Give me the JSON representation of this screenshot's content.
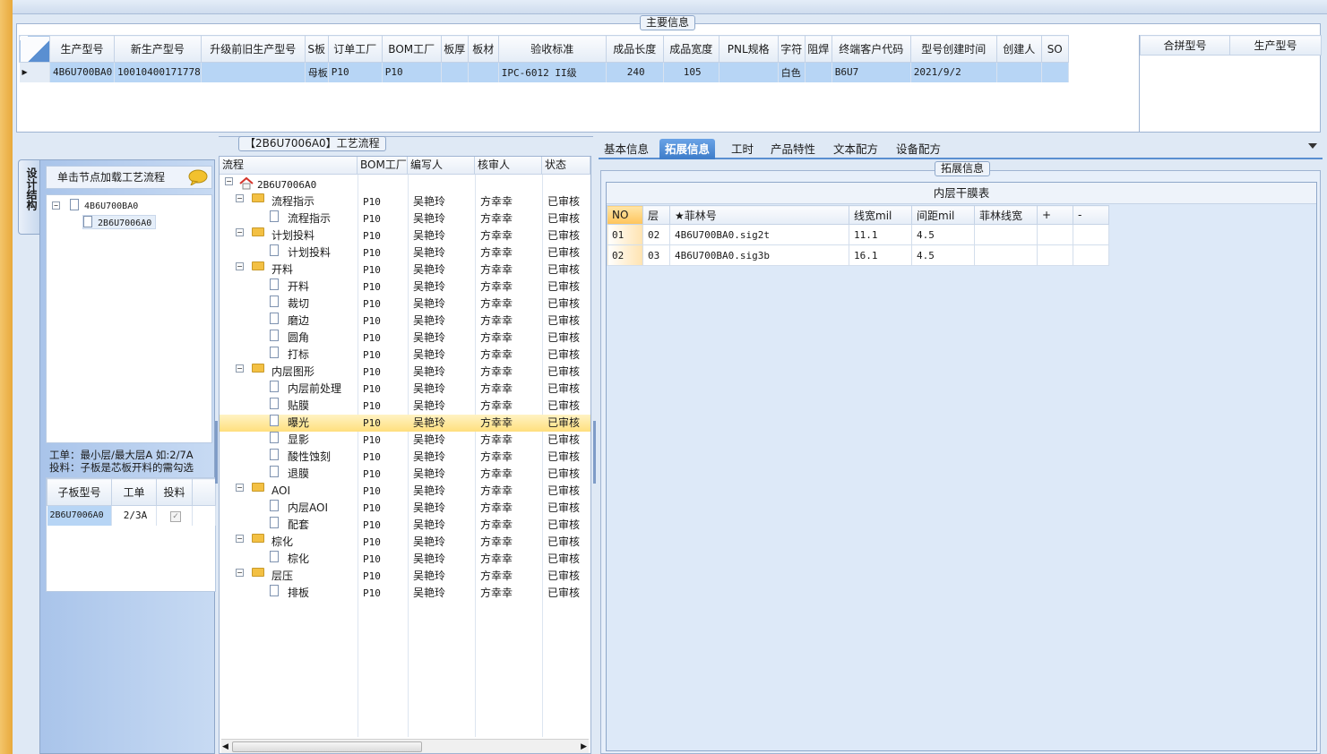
{
  "main_info": {
    "title": "主要信息",
    "columns": [
      "生产型号",
      "新生产型号",
      "升级前旧生产型号",
      "S板",
      "订单工厂",
      "BOM工厂",
      "板厚",
      "板材",
      "验收标准",
      "成品长度",
      "成品宽度",
      "PNL规格",
      "字符",
      "阻焊",
      "终端客户代码",
      "型号创建时间",
      "创建人",
      "SO"
    ],
    "row": [
      "4B6U700BA0",
      "10010400171778",
      "",
      "母板",
      "P10",
      "P10",
      "",
      "",
      "IPC-6012 II级",
      "240",
      "105",
      "",
      "白色",
      "",
      "B6U7",
      "2021/9/2",
      "",
      ""
    ]
  },
  "merge": {
    "columns": [
      "合拼型号",
      "生产型号"
    ]
  },
  "left": {
    "vertical_tab": "设计结构",
    "load_hint": "单击节点加载工艺流程",
    "tree": {
      "root": "4B6U700BA0",
      "child": "2B6U7006A0"
    },
    "note_line1": "工单：最小层/最大层A 如:2/7A",
    "note_line2": "投料：子板是芯板开料的需勾选",
    "sub_table": {
      "columns": [
        "子板型号",
        "工单",
        "投料"
      ],
      "rows": [
        {
          "model": "2B6U7006A0",
          "order": "2/3A",
          "feed": true
        }
      ]
    }
  },
  "process": {
    "title": "【2B6U7006A0】工艺流程",
    "columns": [
      "流程",
      "BOM工厂",
      "编写人",
      "核审人",
      "状态"
    ],
    "root": "2B6U7006A0",
    "rows": [
      {
        "level": 1,
        "name": "流程指示",
        "factory": "P10",
        "writer": "吴艳玲",
        "reviewer": "方幸幸",
        "status": "已审核"
      },
      {
        "level": 2,
        "name": "流程指示",
        "factory": "P10",
        "writer": "吴艳玲",
        "reviewer": "方幸幸",
        "status": "已审核"
      },
      {
        "level": 1,
        "name": "计划投料",
        "factory": "P10",
        "writer": "吴艳玲",
        "reviewer": "方幸幸",
        "status": "已审核"
      },
      {
        "level": 2,
        "name": "计划投料",
        "factory": "P10",
        "writer": "吴艳玲",
        "reviewer": "方幸幸",
        "status": "已审核"
      },
      {
        "level": 1,
        "name": "开料",
        "factory": "P10",
        "writer": "吴艳玲",
        "reviewer": "方幸幸",
        "status": "已审核"
      },
      {
        "level": 2,
        "name": "开料",
        "factory": "P10",
        "writer": "吴艳玲",
        "reviewer": "方幸幸",
        "status": "已审核"
      },
      {
        "level": 2,
        "name": "裁切",
        "factory": "P10",
        "writer": "吴艳玲",
        "reviewer": "方幸幸",
        "status": "已审核"
      },
      {
        "level": 2,
        "name": "磨边",
        "factory": "P10",
        "writer": "吴艳玲",
        "reviewer": "方幸幸",
        "status": "已审核"
      },
      {
        "level": 2,
        "name": "圆角",
        "factory": "P10",
        "writer": "吴艳玲",
        "reviewer": "方幸幸",
        "status": "已审核"
      },
      {
        "level": 2,
        "name": "打标",
        "factory": "P10",
        "writer": "吴艳玲",
        "reviewer": "方幸幸",
        "status": "已审核"
      },
      {
        "level": 1,
        "name": "内层图形",
        "factory": "P10",
        "writer": "吴艳玲",
        "reviewer": "方幸幸",
        "status": "已审核"
      },
      {
        "level": 2,
        "name": "内层前处理",
        "factory": "P10",
        "writer": "吴艳玲",
        "reviewer": "方幸幸",
        "status": "已审核"
      },
      {
        "level": 2,
        "name": "贴膜",
        "factory": "P10",
        "writer": "吴艳玲",
        "reviewer": "方幸幸",
        "status": "已审核"
      },
      {
        "level": 2,
        "name": "曝光",
        "factory": "P10",
        "writer": "吴艳玲",
        "reviewer": "方幸幸",
        "status": "已审核",
        "selected": true
      },
      {
        "level": 2,
        "name": "显影",
        "factory": "P10",
        "writer": "吴艳玲",
        "reviewer": "方幸幸",
        "status": "已审核"
      },
      {
        "level": 2,
        "name": "酸性蚀刻",
        "factory": "P10",
        "writer": "吴艳玲",
        "reviewer": "方幸幸",
        "status": "已审核"
      },
      {
        "level": 2,
        "name": "退膜",
        "factory": "P10",
        "writer": "吴艳玲",
        "reviewer": "方幸幸",
        "status": "已审核"
      },
      {
        "level": 1,
        "name": "AOI",
        "factory": "P10",
        "writer": "吴艳玲",
        "reviewer": "方幸幸",
        "status": "已审核"
      },
      {
        "level": 2,
        "name": "内层AOI",
        "factory": "P10",
        "writer": "吴艳玲",
        "reviewer": "方幸幸",
        "status": "已审核"
      },
      {
        "level": 2,
        "name": "配套",
        "factory": "P10",
        "writer": "吴艳玲",
        "reviewer": "方幸幸",
        "status": "已审核"
      },
      {
        "level": 1,
        "name": "棕化",
        "factory": "P10",
        "writer": "吴艳玲",
        "reviewer": "方幸幸",
        "status": "已审核"
      },
      {
        "level": 2,
        "name": "棕化",
        "factory": "P10",
        "writer": "吴艳玲",
        "reviewer": "方幸幸",
        "status": "已审核"
      },
      {
        "level": 1,
        "name": "层压",
        "factory": "P10",
        "writer": "吴艳玲",
        "reviewer": "方幸幸",
        "status": "已审核"
      },
      {
        "level": 2,
        "name": "排板",
        "factory": "P10",
        "writer": "吴艳玲",
        "reviewer": "方幸幸",
        "status": "已审核"
      }
    ]
  },
  "tabs": [
    {
      "label": "基本信息",
      "active": false
    },
    {
      "label": "拓展信息",
      "active": true
    },
    {
      "label": "工时",
      "active": false
    },
    {
      "label": "产品特性",
      "active": false
    },
    {
      "label": "文本配方",
      "active": false
    },
    {
      "label": "设备配方",
      "active": false
    }
  ],
  "ext": {
    "group_title": "拓展信息",
    "table_title": "内层干膜表",
    "columns": [
      "NO",
      "层",
      "★菲林号",
      "线宽mil",
      "间距mil",
      "菲林线宽",
      "+",
      "-"
    ],
    "rows": [
      [
        "01",
        "02",
        "4B6U700BA0.sig2t",
        "11.1",
        "4.5",
        "",
        "",
        ""
      ],
      [
        "02",
        "03",
        "4B6U700BA0.sig3b",
        "16.1",
        "4.5",
        "",
        "",
        ""
      ]
    ]
  },
  "colors": {
    "selection": "#b7d5f5",
    "highlight": "#ffdf7d",
    "tab_active": "#3d7cc9",
    "accent_strip": "#e8a93c"
  }
}
